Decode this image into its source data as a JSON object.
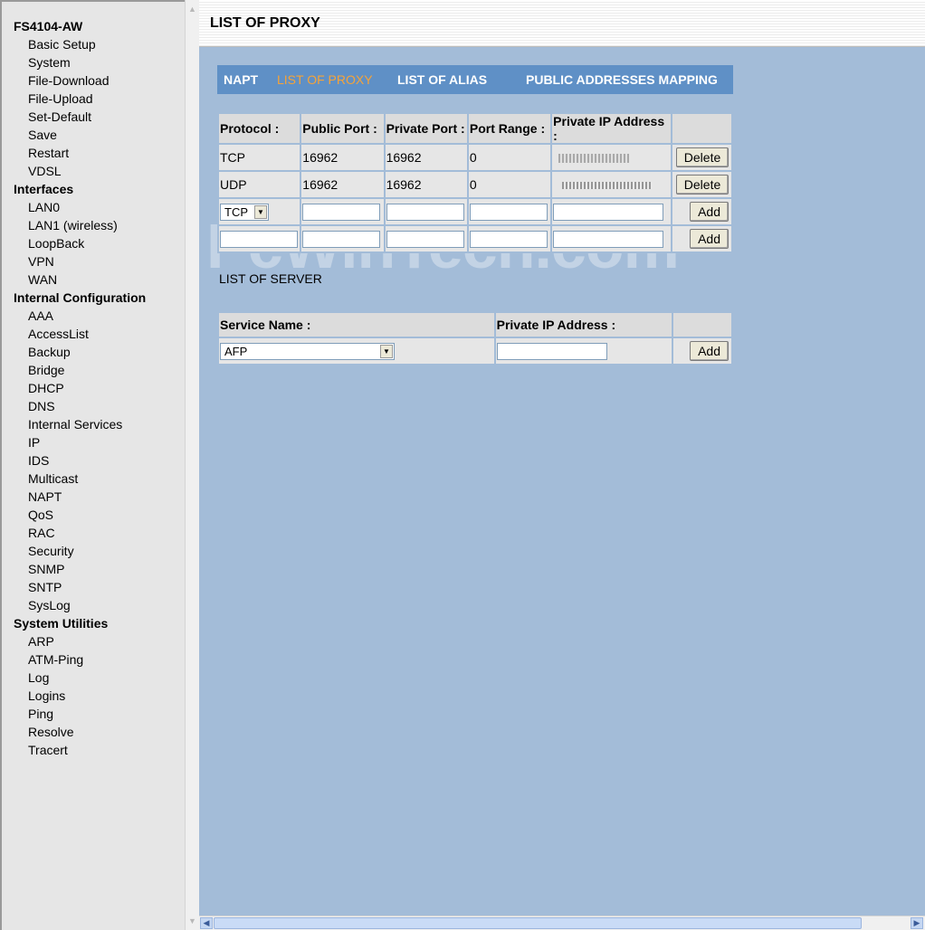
{
  "sidebar": {
    "device": "FS4104-AW",
    "groups": [
      {
        "title": "Interfaces"
      },
      {
        "title": "Internal Configuration"
      },
      {
        "title": "System Utilities"
      }
    ],
    "items": [
      "Basic Setup",
      "System",
      "File-Download",
      "File-Upload",
      "Set-Default",
      "Save",
      "Restart",
      "VDSL",
      "LAN0",
      "LAN1 (wireless)",
      "LoopBack",
      "VPN",
      "WAN",
      "AAA",
      "AccessList",
      "Backup",
      "Bridge",
      "DHCP",
      "DNS",
      "Internal Services",
      "IP",
      "IDS",
      "Multicast",
      "NAPT",
      "QoS",
      "RAC",
      "Security",
      "SNMP",
      "SNTP",
      "SysLog",
      "ARP",
      "ATM-Ping",
      "Log",
      "Logins",
      "Ping",
      "Resolve",
      "Tracert"
    ]
  },
  "page_title": "LIST OF PROXY",
  "tabs": [
    "NAPT",
    "LIST OF PROXY",
    "LIST OF ALIAS",
    "PUBLIC ADDRESSES MAPPING"
  ],
  "proxy_table": {
    "headers": [
      "Protocol :",
      "Public Port :",
      "Private Port :",
      "Port Range :",
      "Private IP Address :"
    ],
    "rows": [
      {
        "protocol": "TCP",
        "public_port": "16962",
        "private_port": "16962",
        "port_range": "0",
        "action": "Delete"
      },
      {
        "protocol": "UDP",
        "public_port": "16962",
        "private_port": "16962",
        "port_range": "0",
        "action": "Delete"
      }
    ],
    "new_row": {
      "protocol": "TCP",
      "action": "Add"
    },
    "extra_row": {
      "action": "Add"
    }
  },
  "server_section": {
    "label": "LIST OF SERVER",
    "headers": [
      "Service Name :",
      "Private IP Address :"
    ],
    "service_value": "AFP",
    "action": "Add"
  },
  "watermark": "PcWinTech.com",
  "colors": {
    "frame_bg": "#a3bcd8",
    "tab_bar": "#5f90c6",
    "tab_active": "#f6a338"
  }
}
